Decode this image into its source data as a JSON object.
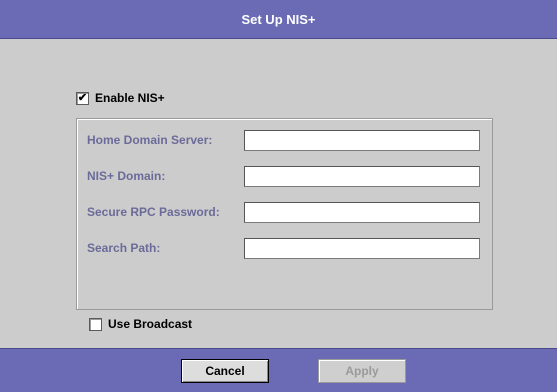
{
  "dialog": {
    "title": "Set Up NIS+"
  },
  "enable": {
    "label": "Enable NIS+",
    "checked": true,
    "check_glyph": "✔"
  },
  "fields": [
    {
      "label": "Home Domain Server:",
      "value": ""
    },
    {
      "label": "NIS+ Domain:",
      "value": ""
    },
    {
      "label": "Secure RPC Password:",
      "value": ""
    },
    {
      "label": "Search Path:",
      "value": ""
    }
  ],
  "broadcast": {
    "label": "Use Broadcast",
    "checked": false
  },
  "buttons": {
    "cancel_label": "Cancel",
    "apply_label": "Apply",
    "apply_enabled": false
  },
  "colors": {
    "title_bar": "#6b6bb5",
    "background": "#cccccc",
    "field_label": "#6b6b9a"
  }
}
